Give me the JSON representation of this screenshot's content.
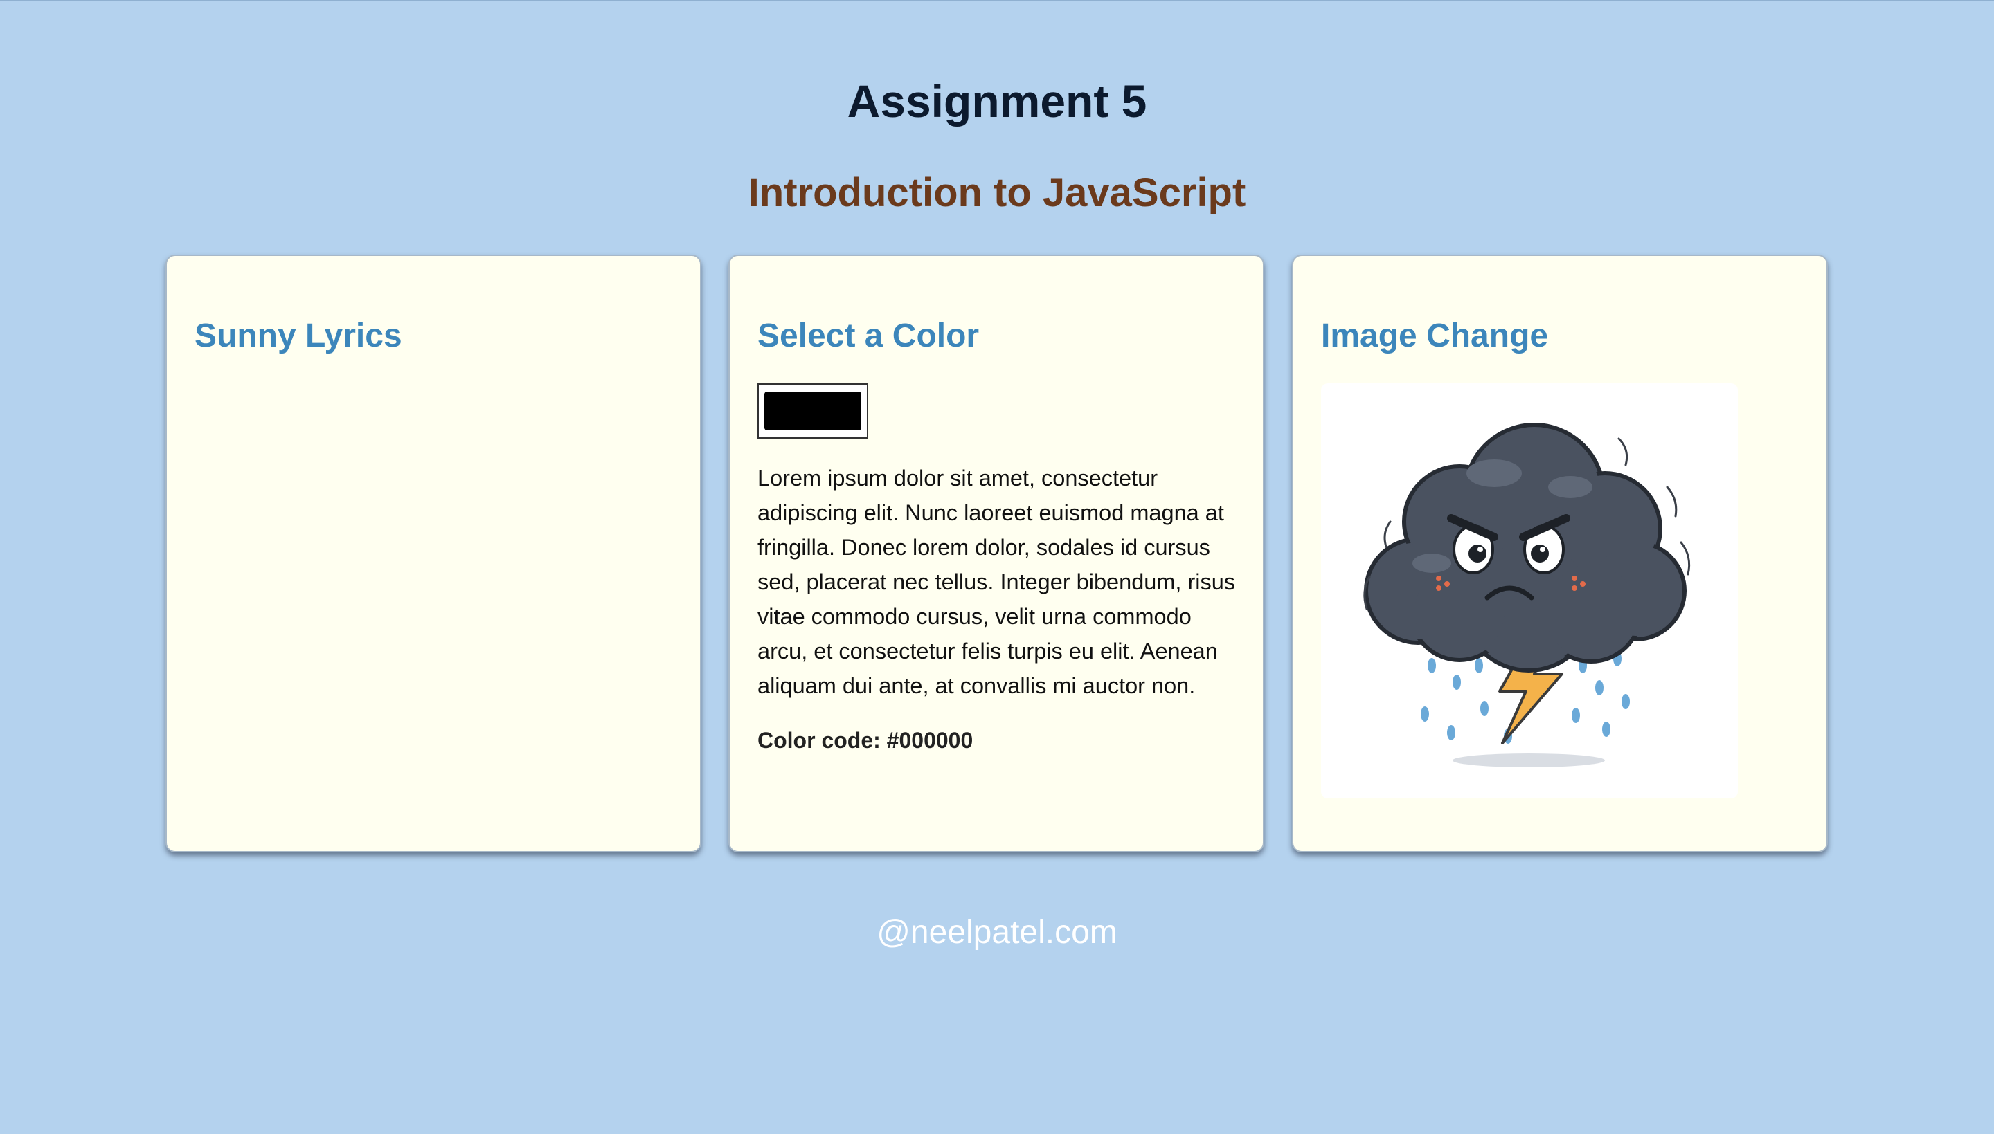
{
  "header": {
    "title": "Assignment 5",
    "subtitle": "Introduction to JavaScript"
  },
  "cards": [
    {
      "title": "Sunny Lyrics"
    },
    {
      "title": "Select a Color",
      "color_value": "#000000",
      "paragraph": "Lorem ipsum dolor sit amet, consectetur adipiscing elit. Nunc laoreet euismod magna at fringilla. Donec lorem dolor, sodales id cursus sed, placerat nec tellus. Integer bibendum, risus vitae commodo cursus, velit urna commodo arcu, et consectetur felis turpis eu elit. Aenean aliquam dui ante, at convallis mi auctor non.",
      "color_code": "Color code: #000000"
    },
    {
      "title": "Image Change",
      "image": "angry-storm-cloud-icon"
    }
  ],
  "footer": {
    "text": "@neelpatel.com"
  },
  "colors": {
    "background": "#b4d2ee",
    "card": "#fffff0",
    "title": "#0c1a2e",
    "subtitle": "#6b3a1c",
    "card_heading": "#3c86bb",
    "footer": "#ffffff"
  }
}
